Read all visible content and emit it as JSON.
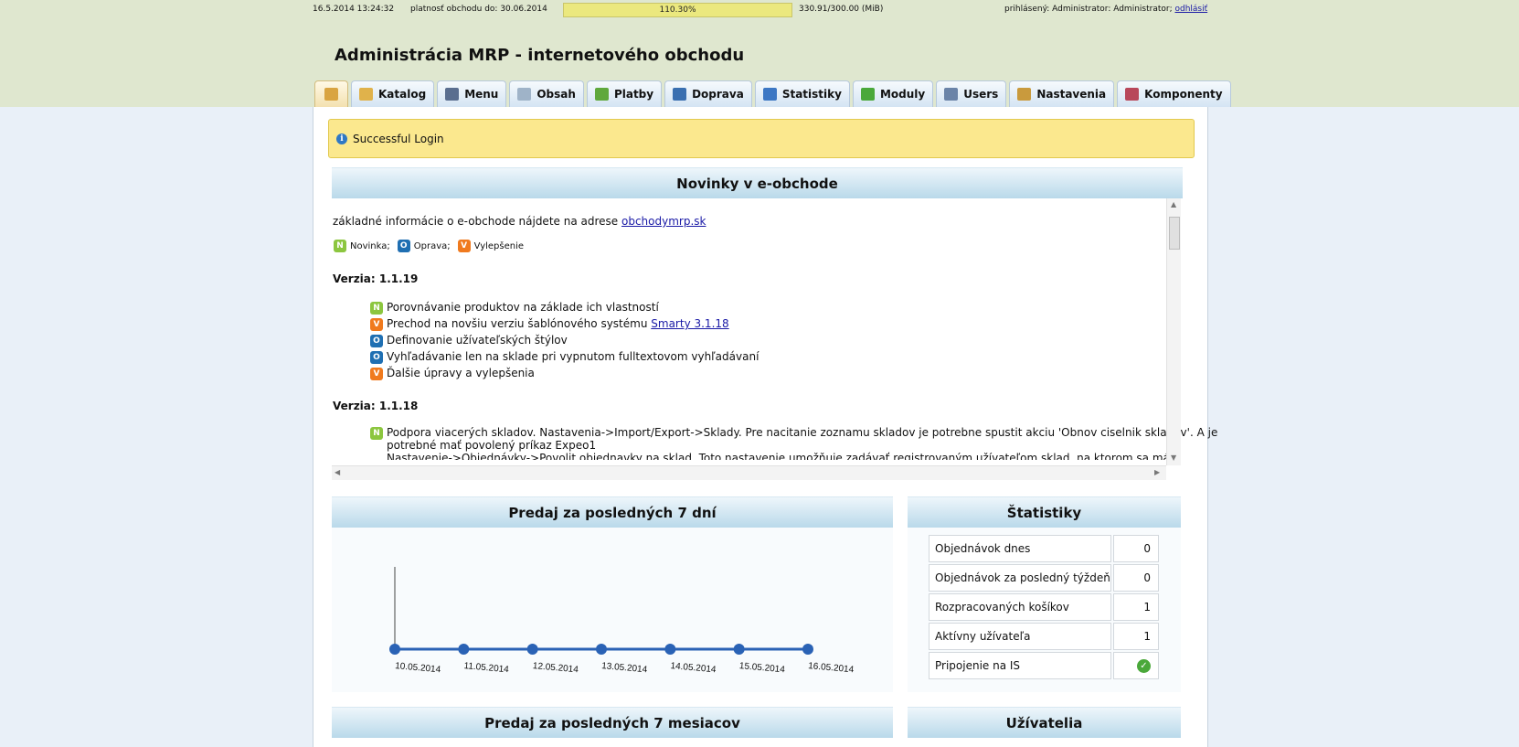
{
  "topbar": {
    "datetime": "16.5.2014 13:24:32",
    "validity_label": "platnosť obchodu do: 30.06.2014",
    "quota_fraction": 1.103,
    "quota_percent": "110.30%",
    "quota_usage": "330.91/300.00 (MiB)",
    "logged_in_label": "prihlásený: Administrator: Administrator;",
    "logout_label": "odhlásiť"
  },
  "header": {
    "title": "Administrácia MRP - internetového obchodu"
  },
  "tabs": [
    {
      "label": "",
      "icon": "home-icon"
    },
    {
      "label": "Katalog",
      "icon": "folder-icon"
    },
    {
      "label": "Menu",
      "icon": "list-icon"
    },
    {
      "label": "Obsah",
      "icon": "page-icon"
    },
    {
      "label": "Platby",
      "icon": "money-icon"
    },
    {
      "label": "Doprava",
      "icon": "truck-icon"
    },
    {
      "label": "Statistiky",
      "icon": "bar-chart-icon"
    },
    {
      "label": "Moduly",
      "icon": "plus-icon"
    },
    {
      "label": "Users",
      "icon": "users-icon"
    },
    {
      "label": "Nastavenia",
      "icon": "settings-folder-icon"
    },
    {
      "label": "Komponenty",
      "icon": "components-icon"
    }
  ],
  "message": {
    "text": "Successful Login"
  },
  "news": {
    "title": "Novinky v e-obchode",
    "intro_text": "základné informácie o e-obchode nájdete na adrese",
    "intro_link": "obchodymrp.sk",
    "legend": [
      {
        "badge": "N",
        "label": "Novinka;"
      },
      {
        "badge": "O",
        "label": "Oprava;"
      },
      {
        "badge": "V",
        "label": "Vylepšenie"
      }
    ],
    "versions": [
      {
        "title": "Verzia: 1.1.19",
        "items": [
          {
            "badge": "N",
            "text": "Porovnávanie produktov na základe ich vlastností",
            "link": ""
          },
          {
            "badge": "V",
            "text": "Prechod na novšiu verziu šablónového systému",
            "link": "Smarty 3.1.18"
          },
          {
            "badge": "O",
            "text": "Definovanie užívateľských štýlov",
            "link": ""
          },
          {
            "badge": "O",
            "text": "Vyhľadávanie len na sklade pri vypnutom fulltextovom vyhľadávaní",
            "link": ""
          },
          {
            "badge": "V",
            "text": "Ďalšie úpravy a vylepšenia",
            "link": ""
          }
        ]
      },
      {
        "title": "Verzia: 1.1.18",
        "items": [
          {
            "badge": "N",
            "text": "Podpora viacerých skladov. Nastavenia->Import/Export->Sklady. Pre nacitanie zoznamu skladov je potrebne spustit akciu 'Obnov ciselnik skladov'. A je",
            "text2": "potrebné mať povolený príkaz Expeo1",
            "text3": "Nastavenie->Objednávky->Povolit objednavky na sklad. Toto nastavenie umožňuje zadávať registrovaným užívateľom sklad, na ktorom sa má"
          }
        ]
      }
    ]
  },
  "sales_week": {
    "title": "Predaj za posledných 7 dní"
  },
  "chart_data": {
    "type": "line",
    "categories": [
      "10.05.2014",
      "11.05.2014",
      "12.05.2014",
      "13.05.2014",
      "14.05.2014",
      "15.05.2014",
      "16.05.2014"
    ],
    "values": [
      0,
      0,
      0,
      0,
      0,
      0,
      0
    ],
    "title": "Predaj za posledných 7 dní",
    "xlabel": "",
    "ylabel": "",
    "grid": false,
    "legend": "none",
    "color": "#2a62b5"
  },
  "stats": {
    "title": "Štatistiky",
    "rows": [
      {
        "label": "Objednávok dnes",
        "value": "0"
      },
      {
        "label": "Objednávok za posledný týždeň",
        "value": "0"
      },
      {
        "label": "Rozpracovaných košíkov",
        "value": "1"
      },
      {
        "label": "Aktívny užívateľa",
        "value": "1"
      },
      {
        "label": "Pripojenie na IS",
        "value": "",
        "icon": "check-icon"
      }
    ]
  },
  "sales_months": {
    "title": "Predaj za posledných 7 mesiacov"
  },
  "users": {
    "title": "Užívatelia"
  }
}
